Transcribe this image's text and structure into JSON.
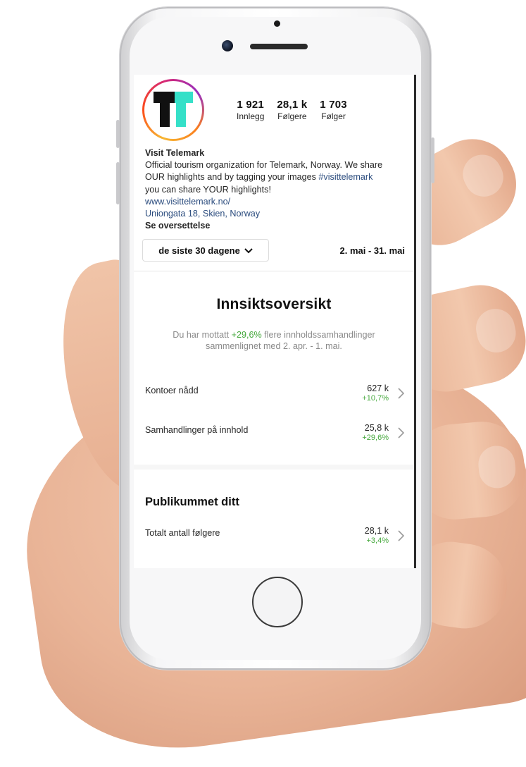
{
  "profile": {
    "logo_text": "T",
    "stats": [
      {
        "value": "1 921",
        "label": "Innlegg"
      },
      {
        "value": "28,1 k",
        "label": "Følgere"
      },
      {
        "value": "1 703",
        "label": "Følger"
      }
    ],
    "name": "Visit Telemark",
    "bio_line1": "Official tourism organization for Telemark, Norway. We share",
    "bio_line2_prefix": "OUR highlights and by tagging your images ",
    "bio_hashtag": "#visittelemark",
    "bio_line3": "you can share YOUR highlights!",
    "website": "www.visittelemark.no/",
    "address": "Uniongata 18, Skien, Norway",
    "translate_label": "Se oversettelse"
  },
  "filter": {
    "range_label": "de siste 30 dagene",
    "date_range": "2. mai - 31. mai"
  },
  "insights": {
    "title": "Innsiktsoversikt",
    "summary_prefix": "Du har mottatt ",
    "summary_highlight": "+29,6%",
    "summary_suffix": " flere innholdssamhandlinger sammenlignet med 2. apr. - 1. mai.",
    "metrics": [
      {
        "label": "Kontoer nådd",
        "value": "627 k",
        "change": "+10,7%"
      },
      {
        "label": "Samhandlinger på innhold",
        "value": "25,8 k",
        "change": "+29,6%"
      }
    ]
  },
  "audience": {
    "title": "Publikummet ditt",
    "metrics": [
      {
        "label": "Totalt antall følgere",
        "value": "28,1 k",
        "change": "+3,4%"
      }
    ]
  },
  "colors": {
    "positive": "#45a83c",
    "link": "#2b4c7e",
    "logo_accent": "#35e0c8"
  }
}
